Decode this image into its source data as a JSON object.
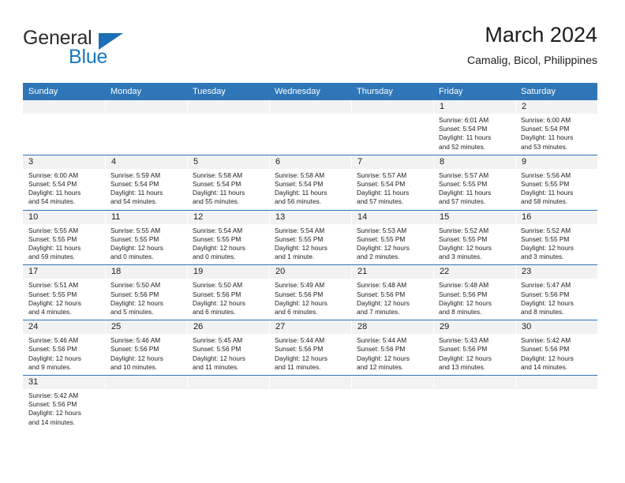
{
  "brand": {
    "name_top": "General",
    "name_bottom": "Blue",
    "triangle_icon": "triangle-icon",
    "colors": {
      "blue": "#1878be",
      "dark": "#2b2b2b",
      "header_blue": "#2e76b8",
      "band_gray": "#f2f2f2"
    }
  },
  "header": {
    "title": "March 2024",
    "subtitle": "Camalig, Bicol, Philippines"
  },
  "calendar": {
    "weekdays": [
      "Sunday",
      "Monday",
      "Tuesday",
      "Wednesday",
      "Thursday",
      "Friday",
      "Saturday"
    ],
    "weeks": [
      [
        {
          "day": "",
          "empty": true
        },
        {
          "day": "",
          "empty": true
        },
        {
          "day": "",
          "empty": true
        },
        {
          "day": "",
          "empty": true
        },
        {
          "day": "",
          "empty": true
        },
        {
          "day": "1",
          "sunrise": "Sunrise: 6:01 AM",
          "sunset": "Sunset: 5:54 PM",
          "daylight_1": "Daylight: 11 hours",
          "daylight_2": "and 52 minutes."
        },
        {
          "day": "2",
          "sunrise": "Sunrise: 6:00 AM",
          "sunset": "Sunset: 5:54 PM",
          "daylight_1": "Daylight: 11 hours",
          "daylight_2": "and 53 minutes."
        }
      ],
      [
        {
          "day": "3",
          "sunrise": "Sunrise: 6:00 AM",
          "sunset": "Sunset: 5:54 PM",
          "daylight_1": "Daylight: 11 hours",
          "daylight_2": "and 54 minutes."
        },
        {
          "day": "4",
          "sunrise": "Sunrise: 5:59 AM",
          "sunset": "Sunset: 5:54 PM",
          "daylight_1": "Daylight: 11 hours",
          "daylight_2": "and 54 minutes."
        },
        {
          "day": "5",
          "sunrise": "Sunrise: 5:58 AM",
          "sunset": "Sunset: 5:54 PM",
          "daylight_1": "Daylight: 11 hours",
          "daylight_2": "and 55 minutes."
        },
        {
          "day": "6",
          "sunrise": "Sunrise: 5:58 AM",
          "sunset": "Sunset: 5:54 PM",
          "daylight_1": "Daylight: 11 hours",
          "daylight_2": "and 56 minutes."
        },
        {
          "day": "7",
          "sunrise": "Sunrise: 5:57 AM",
          "sunset": "Sunset: 5:54 PM",
          "daylight_1": "Daylight: 11 hours",
          "daylight_2": "and 57 minutes."
        },
        {
          "day": "8",
          "sunrise": "Sunrise: 5:57 AM",
          "sunset": "Sunset: 5:55 PM",
          "daylight_1": "Daylight: 11 hours",
          "daylight_2": "and 57 minutes."
        },
        {
          "day": "9",
          "sunrise": "Sunrise: 5:56 AM",
          "sunset": "Sunset: 5:55 PM",
          "daylight_1": "Daylight: 11 hours",
          "daylight_2": "and 58 minutes."
        }
      ],
      [
        {
          "day": "10",
          "sunrise": "Sunrise: 5:55 AM",
          "sunset": "Sunset: 5:55 PM",
          "daylight_1": "Daylight: 11 hours",
          "daylight_2": "and 59 minutes."
        },
        {
          "day": "11",
          "sunrise": "Sunrise: 5:55 AM",
          "sunset": "Sunset: 5:55 PM",
          "daylight_1": "Daylight: 12 hours",
          "daylight_2": "and 0 minutes."
        },
        {
          "day": "12",
          "sunrise": "Sunrise: 5:54 AM",
          "sunset": "Sunset: 5:55 PM",
          "daylight_1": "Daylight: 12 hours",
          "daylight_2": "and 0 minutes."
        },
        {
          "day": "13",
          "sunrise": "Sunrise: 5:54 AM",
          "sunset": "Sunset: 5:55 PM",
          "daylight_1": "Daylight: 12 hours",
          "daylight_2": "and 1 minute."
        },
        {
          "day": "14",
          "sunrise": "Sunrise: 5:53 AM",
          "sunset": "Sunset: 5:55 PM",
          "daylight_1": "Daylight: 12 hours",
          "daylight_2": "and 2 minutes."
        },
        {
          "day": "15",
          "sunrise": "Sunrise: 5:52 AM",
          "sunset": "Sunset: 5:55 PM",
          "daylight_1": "Daylight: 12 hours",
          "daylight_2": "and 3 minutes."
        },
        {
          "day": "16",
          "sunrise": "Sunrise: 5:52 AM",
          "sunset": "Sunset: 5:55 PM",
          "daylight_1": "Daylight: 12 hours",
          "daylight_2": "and 3 minutes."
        }
      ],
      [
        {
          "day": "17",
          "sunrise": "Sunrise: 5:51 AM",
          "sunset": "Sunset: 5:55 PM",
          "daylight_1": "Daylight: 12 hours",
          "daylight_2": "and 4 minutes."
        },
        {
          "day": "18",
          "sunrise": "Sunrise: 5:50 AM",
          "sunset": "Sunset: 5:56 PM",
          "daylight_1": "Daylight: 12 hours",
          "daylight_2": "and 5 minutes."
        },
        {
          "day": "19",
          "sunrise": "Sunrise: 5:50 AM",
          "sunset": "Sunset: 5:56 PM",
          "daylight_1": "Daylight: 12 hours",
          "daylight_2": "and 6 minutes."
        },
        {
          "day": "20",
          "sunrise": "Sunrise: 5:49 AM",
          "sunset": "Sunset: 5:56 PM",
          "daylight_1": "Daylight: 12 hours",
          "daylight_2": "and 6 minutes."
        },
        {
          "day": "21",
          "sunrise": "Sunrise: 5:48 AM",
          "sunset": "Sunset: 5:56 PM",
          "daylight_1": "Daylight: 12 hours",
          "daylight_2": "and 7 minutes."
        },
        {
          "day": "22",
          "sunrise": "Sunrise: 5:48 AM",
          "sunset": "Sunset: 5:56 PM",
          "daylight_1": "Daylight: 12 hours",
          "daylight_2": "and 8 minutes."
        },
        {
          "day": "23",
          "sunrise": "Sunrise: 5:47 AM",
          "sunset": "Sunset: 5:56 PM",
          "daylight_1": "Daylight: 12 hours",
          "daylight_2": "and 8 minutes."
        }
      ],
      [
        {
          "day": "24",
          "sunrise": "Sunrise: 5:46 AM",
          "sunset": "Sunset: 5:56 PM",
          "daylight_1": "Daylight: 12 hours",
          "daylight_2": "and 9 minutes."
        },
        {
          "day": "25",
          "sunrise": "Sunrise: 5:46 AM",
          "sunset": "Sunset: 5:56 PM",
          "daylight_1": "Daylight: 12 hours",
          "daylight_2": "and 10 minutes."
        },
        {
          "day": "26",
          "sunrise": "Sunrise: 5:45 AM",
          "sunset": "Sunset: 5:56 PM",
          "daylight_1": "Daylight: 12 hours",
          "daylight_2": "and 11 minutes."
        },
        {
          "day": "27",
          "sunrise": "Sunrise: 5:44 AM",
          "sunset": "Sunset: 5:56 PM",
          "daylight_1": "Daylight: 12 hours",
          "daylight_2": "and 11 minutes."
        },
        {
          "day": "28",
          "sunrise": "Sunrise: 5:44 AM",
          "sunset": "Sunset: 5:56 PM",
          "daylight_1": "Daylight: 12 hours",
          "daylight_2": "and 12 minutes."
        },
        {
          "day": "29",
          "sunrise": "Sunrise: 5:43 AM",
          "sunset": "Sunset: 5:56 PM",
          "daylight_1": "Daylight: 12 hours",
          "daylight_2": "and 13 minutes."
        },
        {
          "day": "30",
          "sunrise": "Sunrise: 5:42 AM",
          "sunset": "Sunset: 5:56 PM",
          "daylight_1": "Daylight: 12 hours",
          "daylight_2": "and 14 minutes."
        }
      ],
      [
        {
          "day": "31",
          "sunrise": "Sunrise: 5:42 AM",
          "sunset": "Sunset: 5:56 PM",
          "daylight_1": "Daylight: 12 hours",
          "daylight_2": "and 14 minutes."
        },
        {
          "day": "",
          "empty": true
        },
        {
          "day": "",
          "empty": true
        },
        {
          "day": "",
          "empty": true
        },
        {
          "day": "",
          "empty": true
        },
        {
          "day": "",
          "empty": true
        },
        {
          "day": "",
          "empty": true
        }
      ]
    ]
  }
}
